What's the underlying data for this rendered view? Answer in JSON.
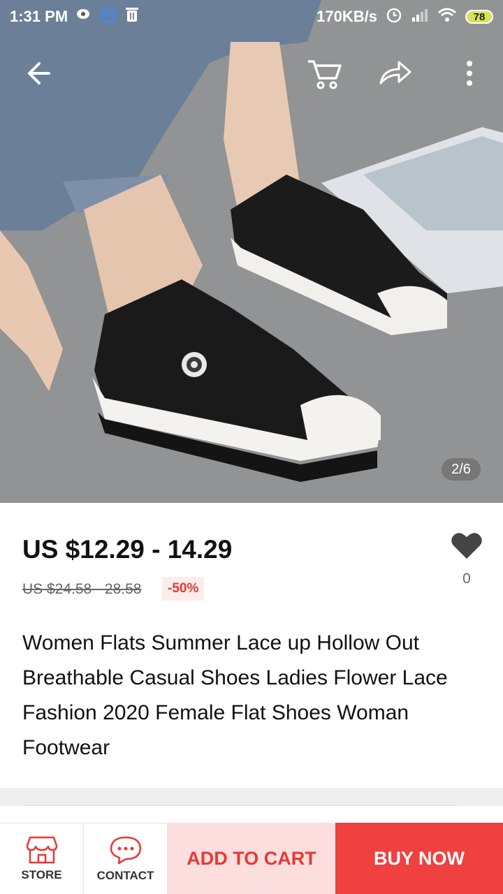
{
  "statusbar": {
    "time": "1:31 PM",
    "network_speed": "170KB/s",
    "battery": "78"
  },
  "gallery": {
    "indicator": "2/6"
  },
  "product": {
    "price": "US $12.29 - 14.29",
    "original_price": "US $24.58 - 28.58",
    "discount": "-50%",
    "wishlist_count": "0",
    "title": "Women Flats Summer Lace up Hollow Out Breathable Casual Shoes Ladies Flower Lace Fashion 2020 Female Flat Shoes Woman Footwear"
  },
  "bottom_bar": {
    "store_label": "STORE",
    "contact_label": "CONTACT",
    "add_to_cart_label": "ADD TO CART",
    "buy_now_label": "BUY NOW"
  },
  "colors": {
    "accent": "#e53935",
    "buy_now_bg": "#f0403f",
    "add_to_cart_bg": "#fddede"
  }
}
